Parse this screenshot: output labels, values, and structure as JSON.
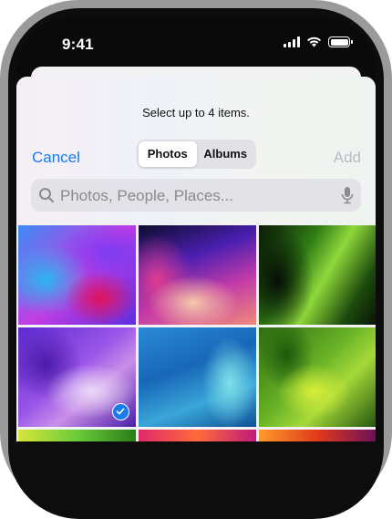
{
  "status_bar": {
    "time": "9:41"
  },
  "picker": {
    "prompt": "Select up to 4 items.",
    "cancel_label": "Cancel",
    "add_label": "Add",
    "tabs": [
      {
        "label": "Photos",
        "selected": true
      },
      {
        "label": "Albums",
        "selected": false
      }
    ],
    "search": {
      "placeholder": "Photos, People, Places...",
      "value": ""
    }
  },
  "photos": [
    {
      "name": "photo-1",
      "selected": false
    },
    {
      "name": "photo-2",
      "selected": false
    },
    {
      "name": "photo-3",
      "selected": false
    },
    {
      "name": "photo-4",
      "selected": true
    },
    {
      "name": "photo-5",
      "selected": false
    },
    {
      "name": "photo-6",
      "selected": false
    },
    {
      "name": "photo-7",
      "selected": false
    },
    {
      "name": "photo-8",
      "selected": false
    },
    {
      "name": "photo-9",
      "selected": false
    }
  ],
  "colors": {
    "accent": "#1a7af0",
    "disabled": "#b9bcc4",
    "device_frame": "#9a9a9a"
  }
}
